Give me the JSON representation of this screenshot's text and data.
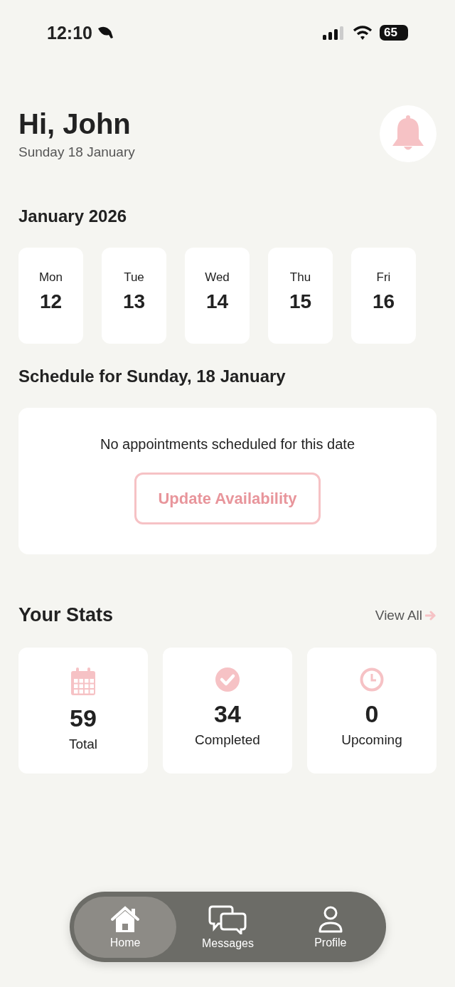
{
  "status_bar": {
    "time": "12:10",
    "battery": "65"
  },
  "header": {
    "greeting": "Hi, John",
    "date": "Sunday 18 January"
  },
  "calendar": {
    "month": "January 2026",
    "days": [
      {
        "weekday": "Mon",
        "day": "12",
        "selected": false
      },
      {
        "weekday": "Tue",
        "day": "13",
        "selected": false
      },
      {
        "weekday": "Wed",
        "day": "14",
        "selected": false
      },
      {
        "weekday": "Thu",
        "day": "15",
        "selected": false
      },
      {
        "weekday": "Fri",
        "day": "16",
        "selected": false
      }
    ]
  },
  "schedule": {
    "title": "Schedule for Sunday, 18 January",
    "empty_message": "No appointments scheduled for this date",
    "button": "Update Availability"
  },
  "stats": {
    "title": "Your Stats",
    "link": "View All",
    "items": [
      {
        "kind": "calendar",
        "value": "59",
        "label": "Total"
      },
      {
        "kind": "check",
        "value": "34",
        "label": "Completed"
      },
      {
        "kind": "clock",
        "value": "0",
        "label": "Upcoming"
      }
    ]
  },
  "tab_bar": [
    {
      "kind": "home",
      "label": "Home",
      "selected": true
    },
    {
      "kind": "messages",
      "label": "Messages",
      "selected": false
    },
    {
      "kind": "profile",
      "label": "Profile",
      "selected": false
    }
  ]
}
